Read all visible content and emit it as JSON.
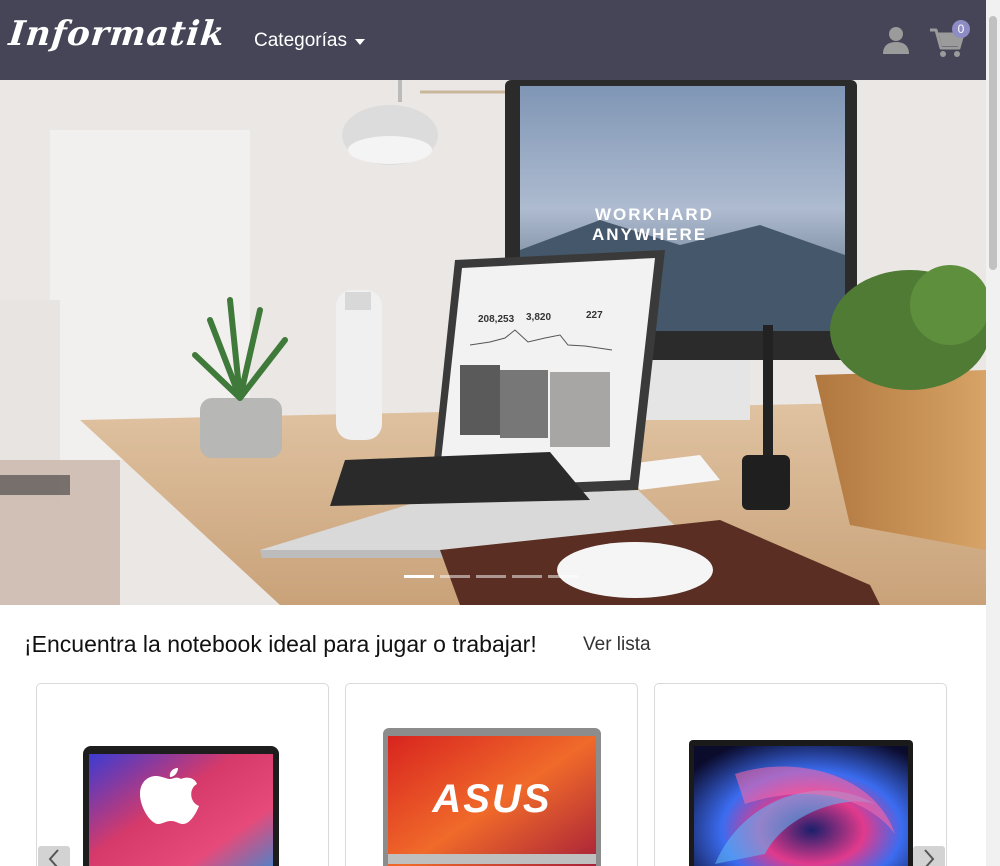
{
  "navbar": {
    "brand": "Informatik",
    "categories_label": "Categorías",
    "cart_count": "0",
    "user_icon": "user-icon",
    "cart_icon": "cart-icon"
  },
  "hero": {
    "screen_text_line1": "WORKHARD",
    "screen_text_line2": "ANYWHERE",
    "laptop_stat1": "208,253",
    "laptop_stat2": "3,820",
    "laptop_stat3": "227",
    "slides": 5,
    "active_slide": 1
  },
  "section": {
    "title": "¡Encuentra la notebook ideal para jugar o trabajar!",
    "link": "Ver lista"
  },
  "products": [
    {
      "brand_logo": "apple-logo"
    },
    {
      "brand_logo": "ASUS"
    },
    {
      "brand_logo": "swirl-wallpaper"
    }
  ],
  "colors": {
    "navbar_bg": "#464557",
    "badge_bg": "#8e8cc4",
    "accent_text": "#ffffff"
  }
}
